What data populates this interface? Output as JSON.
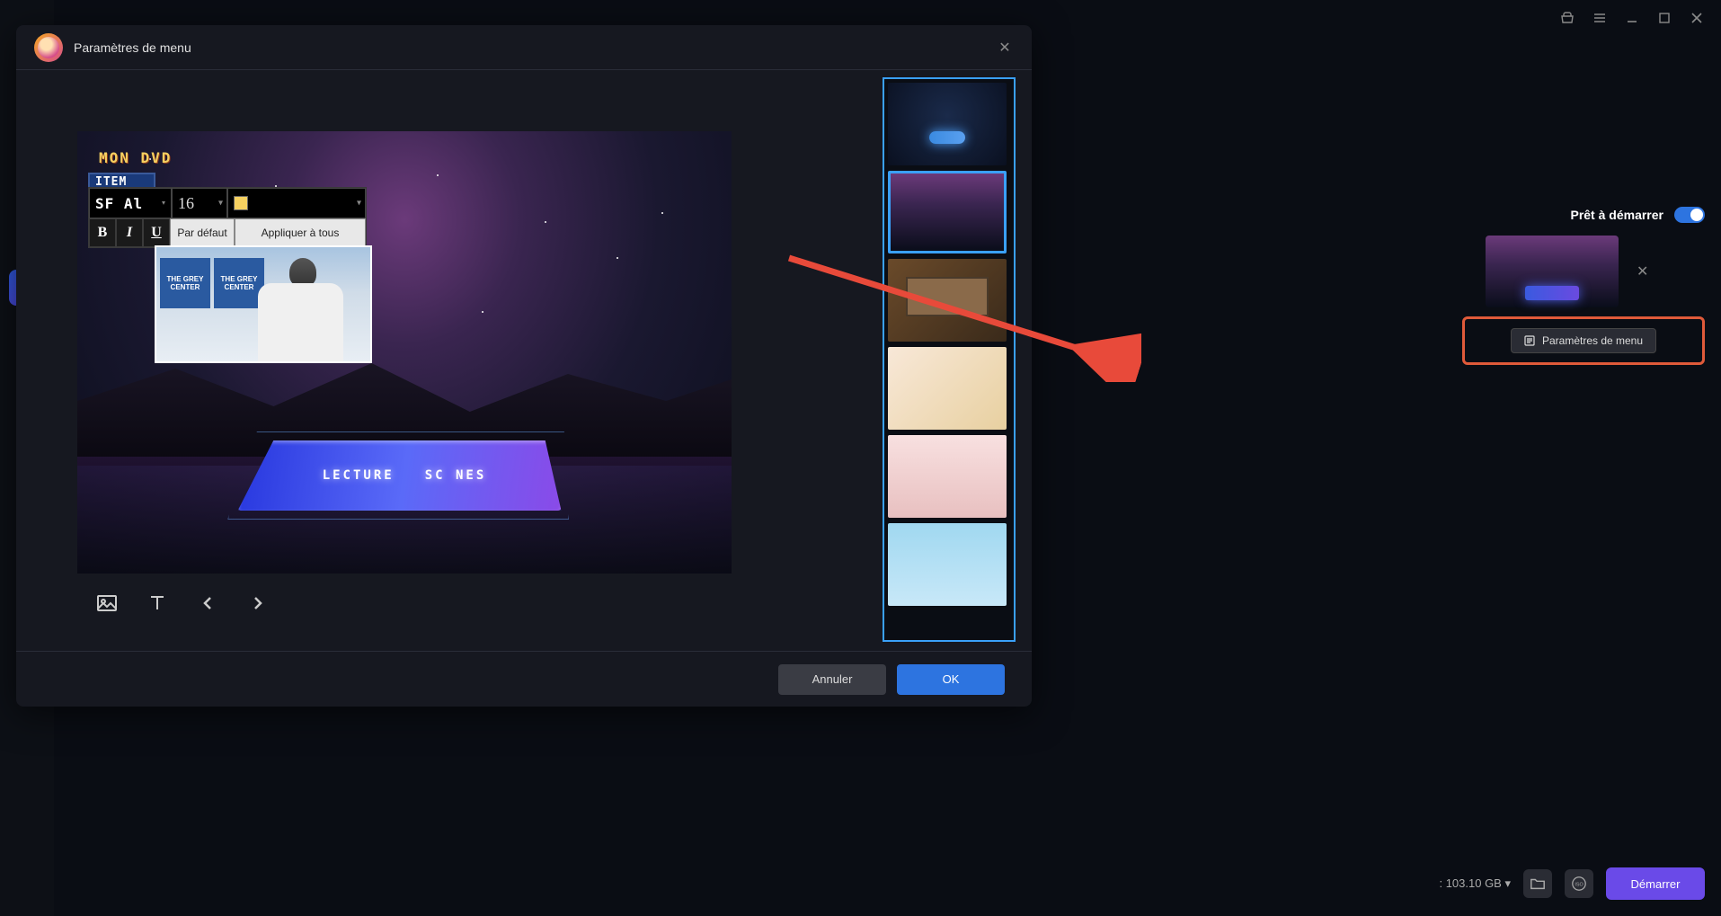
{
  "modal": {
    "title": "Paramètres de menu",
    "preview": {
      "dvd_title": "MON DVD",
      "item_label": "ITEM",
      "menu_button_1": "LECTURE",
      "menu_button_2": "SC NES",
      "clip_sign_1_line1": "THE GREY",
      "clip_sign_1_line2": "CENTER",
      "clip_sign_2_line1": "THE GREY",
      "clip_sign_2_line2": "CENTER"
    },
    "text_toolbar": {
      "font_family": "SF Al",
      "font_size": "16",
      "color": "#f5d060",
      "bold_label": "B",
      "italic_label": "I",
      "underline_label": "U",
      "default_label": "Par défaut",
      "apply_all_label": "Appliquer à tous"
    },
    "buttons": {
      "cancel": "Annuler",
      "ok": "OK"
    },
    "templates": [
      {
        "id": "tmpl-neon",
        "selected": false
      },
      {
        "id": "tmpl-galaxy",
        "selected": true
      },
      {
        "id": "tmpl-filmstrip",
        "selected": false
      },
      {
        "id": "tmpl-flowers",
        "selected": false
      },
      {
        "id": "tmpl-wedding",
        "selected": false
      },
      {
        "id": "tmpl-ocean",
        "selected": false
      }
    ]
  },
  "right_panel": {
    "ready_label": "Prêt à démarrer",
    "toggle_on": true,
    "settings_button_label": "Paramètres de menu"
  },
  "bottom_bar": {
    "storage_value": ": 103.10 GB ▾",
    "start_label": "Démarrer"
  },
  "titlebar_icons": [
    "shop-icon",
    "menu-icon",
    "minimize-icon",
    "maximize-icon",
    "close-icon"
  ],
  "sidebar_icons": [
    "home-icon",
    "history-icon",
    "open-icon",
    "disc-icon",
    "film-icon",
    "ghost-icon",
    "list-icon",
    "clipboard-icon",
    "archive-icon"
  ],
  "colors": {
    "accent_blue": "#2d74e0",
    "accent_purple": "#6a4ae8",
    "highlight_orange": "#e05a3a"
  }
}
